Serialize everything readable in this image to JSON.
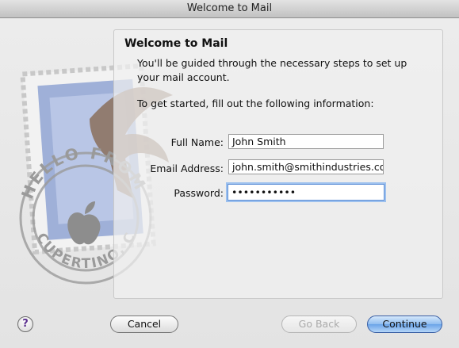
{
  "window": {
    "title": "Welcome to Mail"
  },
  "stamp": {
    "top_text": "HELLO FROM",
    "bottom_text": "CUPERTINO, CA"
  },
  "panel": {
    "heading": "Welcome to Mail",
    "intro": "You'll be guided through the necessary steps to set up your mail account.",
    "instruction": "To get started, fill out the following information:"
  },
  "form": {
    "full_name": {
      "label": "Full Name:",
      "value": "John Smith"
    },
    "email": {
      "label": "Email Address:",
      "value": "john.smith@smithindustries.co"
    },
    "password": {
      "label": "Password:",
      "value": "•••••••••••"
    }
  },
  "buttons": {
    "help": "?",
    "cancel": "Cancel",
    "go_back": "Go Back",
    "continue": "Continue"
  }
}
